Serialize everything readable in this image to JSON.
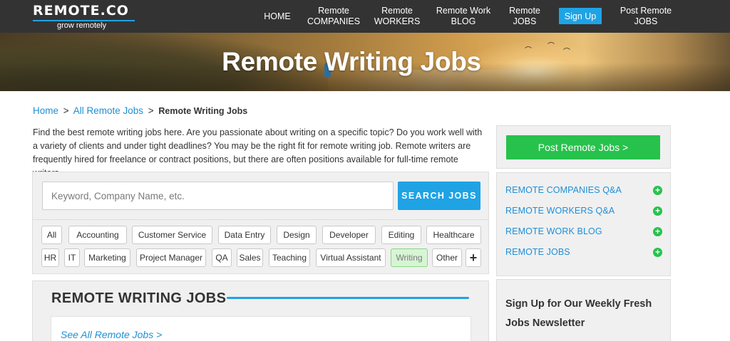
{
  "logo": {
    "brand": "REMOTE.CO",
    "tagline": "grow remotely"
  },
  "nav": {
    "home": "HOME",
    "remote_companies_line1": "Remote",
    "remote_companies_line2": "COMPANIES",
    "remote_workers_line1": "Remote",
    "remote_workers_line2": "WORKERS",
    "remote_work_blog_line1": "Remote Work",
    "remote_work_blog_line2": "BLOG",
    "remote_jobs_line1": "Remote",
    "remote_jobs_line2": "JOBS",
    "signup": "Sign Up",
    "post_remote_jobs_line1": "Post Remote",
    "post_remote_jobs_line2": "JOBS"
  },
  "hero": {
    "title": "Remote Writing Jobs"
  },
  "breadcrumb": {
    "home": "Home",
    "sep1": ">",
    "all_jobs": "All Remote Jobs",
    "sep2": ">",
    "current": "Remote Writing Jobs"
  },
  "intro": "Find the best remote writing jobs here. Are you passionate about writing on a specific topic? Do you work well with a variety of clients and under tight deadlines? You may be the right fit for remote writing job. Remote writers are frequently hired for freelance or contract positions, but there are often positions available for full-time remote writers.",
  "search": {
    "placeholder": "Keyword, Company Name, etc.",
    "value": "",
    "button": "SEARCH JOBS"
  },
  "categories": {
    "row1": [
      "All",
      "Accounting",
      "Customer Service",
      "Data Entry",
      "Design",
      "Developer",
      "Editing",
      "Healthcare"
    ],
    "row2": [
      "HR",
      "IT",
      "Marketing",
      "Project Manager",
      "QA",
      "Sales",
      "Teaching",
      "Virtual Assistant",
      "Writing",
      "Other"
    ],
    "selected": "Writing",
    "more": "+"
  },
  "jobs": {
    "heading": "REMOTE WRITING JOBS",
    "see_all": "See All Remote Jobs >"
  },
  "sidebar": {
    "post_jobs_button": "Post Remote Jobs >",
    "links": [
      "REMOTE COMPANIES Q&A",
      "REMOTE WORKERS Q&A",
      "REMOTE WORK BLOG",
      "REMOTE JOBS"
    ],
    "newsletter_title": "Sign Up for Our Weekly Fresh Jobs Newsletter"
  },
  "colors": {
    "accent_blue": "#1fa3e5",
    "link_blue": "#1f8fd6",
    "green": "#27c24c",
    "nav_bg": "#333333",
    "panel_bg": "#f0f0f0"
  },
  "icons": {
    "expand": "plus-circle-icon",
    "more_categories": "plus-icon"
  }
}
